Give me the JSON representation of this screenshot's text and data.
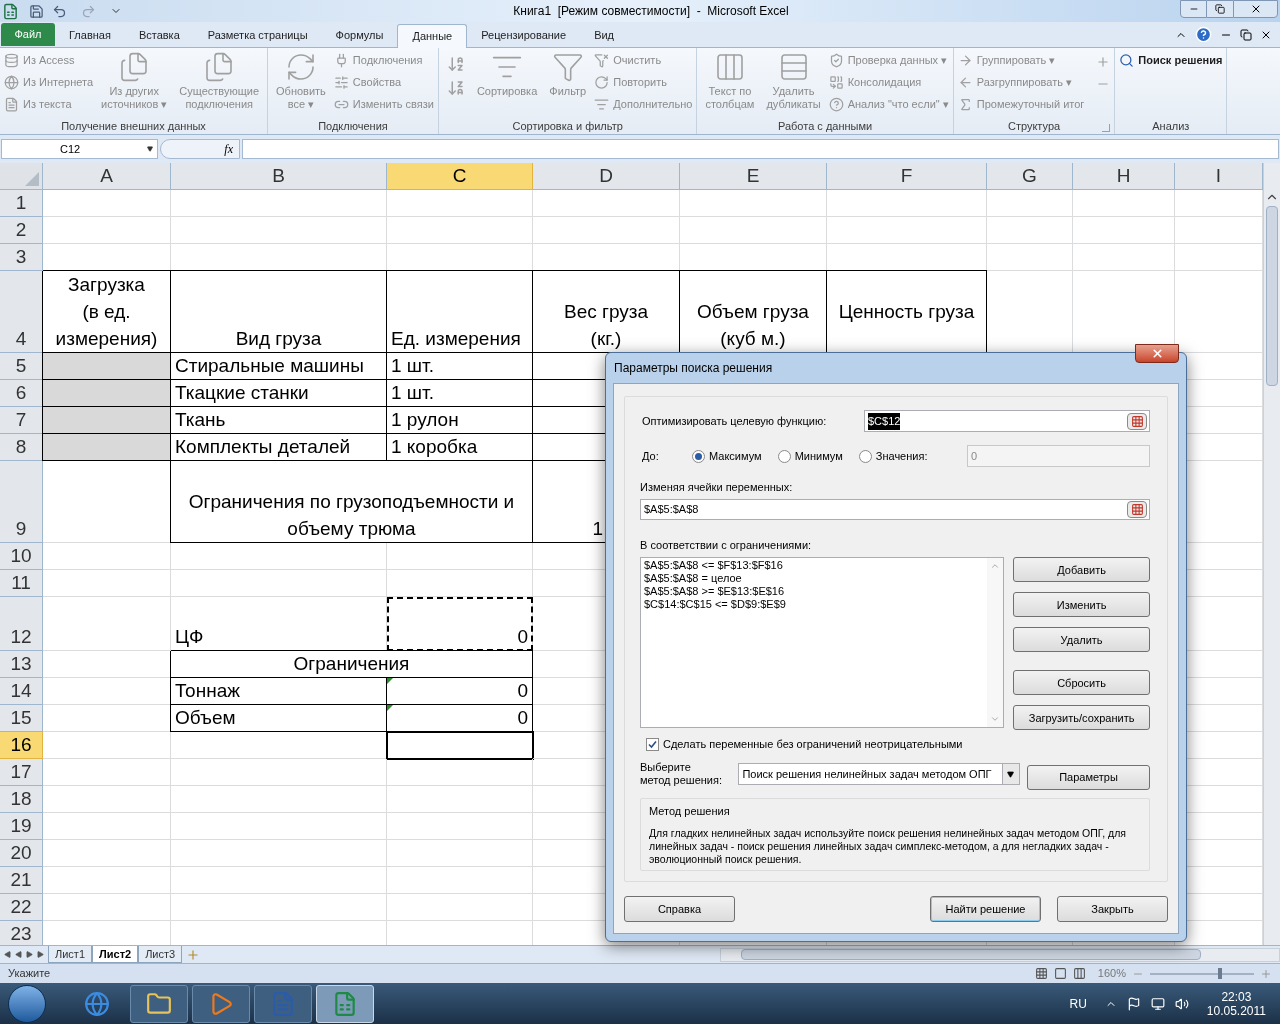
{
  "window": {
    "title": "Книга1  [Режим совместимости]  -  Microsoft Excel"
  },
  "ribbon_tabs": [
    {
      "label": "Файл",
      "kind": "file",
      "selected": false
    },
    {
      "label": "Главная",
      "kind": "tab",
      "selected": false
    },
    {
      "label": "Вставка",
      "kind": "tab",
      "selected": false
    },
    {
      "label": "Разметка страницы",
      "kind": "tab",
      "selected": false
    },
    {
      "label": "Формулы",
      "kind": "tab",
      "selected": false
    },
    {
      "label": "Данные",
      "kind": "tab",
      "selected": true
    },
    {
      "label": "Рецензирование",
      "kind": "tab",
      "selected": false
    },
    {
      "label": "Вид",
      "kind": "tab",
      "selected": false
    }
  ],
  "ribbon_groups": [
    {
      "label": "Получение внешних данных",
      "items": [
        {
          "label": "Из Access",
          "kind": "small",
          "disabled": true
        },
        {
          "label": "Из Интернета",
          "kind": "small",
          "disabled": true
        },
        {
          "label": "Из текста",
          "kind": "small",
          "disabled": true
        },
        {
          "label": "Из других\nисточников ▾",
          "kind": "large",
          "disabled": true
        },
        {
          "label": "Существующие\nподключения",
          "kind": "large",
          "disabled": true
        }
      ]
    },
    {
      "label": "Подключения",
      "items": [
        {
          "label": "Обновить\nвсе ▾",
          "kind": "large",
          "disabled": true
        },
        {
          "label": "Подключения",
          "kind": "small",
          "disabled": true
        },
        {
          "label": "Свойства",
          "kind": "small",
          "disabled": true
        },
        {
          "label": "Изменить связи",
          "kind": "small",
          "disabled": true
        }
      ]
    },
    {
      "label": "Сортировка и фильтр",
      "items": [
        {
          "label": "Сортировка",
          "kind": "large",
          "disabled": true
        },
        {
          "label": "Фильтр",
          "kind": "large",
          "disabled": true
        },
        {
          "label": "Очистить",
          "kind": "small",
          "disabled": true
        },
        {
          "label": "Повторить",
          "kind": "small",
          "disabled": true
        },
        {
          "label": "Дополнительно",
          "kind": "small",
          "disabled": true
        }
      ]
    },
    {
      "label": "Работа с данными",
      "items": [
        {
          "label": "Текст по\nстолбцам",
          "kind": "large",
          "disabled": true
        },
        {
          "label": "Удалить\nдубликаты",
          "kind": "large",
          "disabled": true
        },
        {
          "label": "Проверка данных ▾",
          "kind": "small",
          "disabled": true
        },
        {
          "label": "Консолидация",
          "kind": "small",
          "disabled": true
        },
        {
          "label": "Анализ \"что если\" ▾",
          "kind": "small",
          "disabled": true
        }
      ]
    },
    {
      "label": "Структура",
      "items": [
        {
          "label": "Группировать ▾",
          "kind": "small",
          "disabled": true
        },
        {
          "label": "Разгруппировать ▾",
          "kind": "small",
          "disabled": true
        },
        {
          "label": "Промежуточный итог",
          "kind": "small",
          "disabled": true
        }
      ]
    },
    {
      "label": "Анализ",
      "items": [
        {
          "label": "Поиск решения",
          "kind": "small",
          "disabled": false
        }
      ]
    }
  ],
  "name_box": "C12",
  "function_label": "fx",
  "columns": [
    {
      "label": "A",
      "selected": false
    },
    {
      "label": "B",
      "selected": false
    },
    {
      "label": "C",
      "selected": true
    },
    {
      "label": "D",
      "selected": false
    },
    {
      "label": "E",
      "selected": false
    },
    {
      "label": "F",
      "selected": false
    },
    {
      "label": "G",
      "selected": false
    },
    {
      "label": "H",
      "selected": false
    },
    {
      "label": "I",
      "selected": false
    }
  ],
  "rows": [
    {
      "label": "1",
      "selected": false,
      "cells": {}
    },
    {
      "label": "2",
      "selected": false,
      "cells": {}
    },
    {
      "label": "3",
      "selected": false,
      "cells": {}
    },
    {
      "label": "4",
      "selected": false,
      "cells": {
        "A": {
          "text": "Загрузка\n(в ед.\nизмерения)",
          "kind": "header",
          "boxed": true
        },
        "B": {
          "text": "Вид груза",
          "kind": "header",
          "boxed": true
        },
        "C": {
          "text": "Ед. измерения",
          "kind": "text",
          "boxed": true
        },
        "D": {
          "text": "Вес груза\n(кг.)",
          "kind": "header",
          "boxed": true
        },
        "E": {
          "text": "Объем груза\n(куб м.)",
          "kind": "header",
          "boxed": true
        },
        "F": {
          "text": "Ценность груза",
          "kind": "header_middle",
          "boxed": true
        }
      }
    },
    {
      "label": "5",
      "selected": false,
      "cells": {
        "A": {
          "shaded": true,
          "boxed": true
        },
        "B": {
          "text": "Стиральные машины",
          "kind": "text",
          "boxed": true
        },
        "C": {
          "text": "1 шт.",
          "kind": "text",
          "boxed": true
        },
        "D": {
          "boxed": true
        }
      }
    },
    {
      "label": "6",
      "selected": false,
      "cells": {
        "A": {
          "shaded": true,
          "boxed": true
        },
        "B": {
          "text": "Ткацкие станки",
          "kind": "text",
          "boxed": true
        },
        "C": {
          "text": "1 шт.",
          "kind": "text",
          "boxed": true
        },
        "D": {
          "boxed": true
        }
      }
    },
    {
      "label": "7",
      "selected": false,
      "cells": {
        "A": {
          "shaded": true,
          "boxed": true
        },
        "B": {
          "text": "Ткань",
          "kind": "text",
          "boxed": true
        },
        "C": {
          "text": "1 рулон",
          "kind": "text",
          "boxed": true
        },
        "D": {
          "boxed": true
        }
      }
    },
    {
      "label": "8",
      "selected": false,
      "cells": {
        "A": {
          "shaded": true,
          "boxed": true
        },
        "B": {
          "text": "Комплекты деталей",
          "kind": "text",
          "boxed": true
        },
        "C": {
          "text": "1 коробка",
          "kind": "text",
          "boxed": true
        },
        "D": {
          "boxed": true
        }
      }
    },
    {
      "label": "9",
      "selected": false,
      "cells": {
        "B": {
          "text": "Ограничения по грузоподъемности и\nобъему трюма",
          "kind": "header",
          "boxed": true,
          "merged": true
        },
        "D": {
          "text": "1",
          "kind": "partial",
          "boxed": true
        }
      }
    },
    {
      "label": "10",
      "selected": false,
      "cells": {}
    },
    {
      "label": "11",
      "selected": false,
      "cells": {}
    },
    {
      "label": "12",
      "selected": false,
      "cells": {
        "B": {
          "text": "ЦФ",
          "kind": "text"
        },
        "C": {
          "text": "0",
          "kind": "number",
          "marquee": true
        }
      }
    },
    {
      "label": "13",
      "selected": false,
      "cells": {
        "B": {
          "text": "Ограничения",
          "kind": "header",
          "boxed": true,
          "merged": true
        }
      }
    },
    {
      "label": "14",
      "selected": false,
      "cells": {
        "B": {
          "text": "Тоннаж",
          "kind": "text",
          "boxed": true
        },
        "C": {
          "text": "0",
          "kind": "number",
          "boxed": true,
          "flag": true
        }
      }
    },
    {
      "label": "15",
      "selected": false,
      "cells": {
        "B": {
          "text": "Объем",
          "kind": "text",
          "boxed": true
        },
        "C": {
          "text": "0",
          "kind": "number",
          "boxed": true,
          "flag": true
        }
      }
    },
    {
      "label": "16",
      "selected": true,
      "cells": {
        "C": {
          "active": true
        }
      }
    },
    {
      "label": "17",
      "selected": false,
      "cells": {}
    },
    {
      "label": "18",
      "selected": false,
      "cells": {}
    },
    {
      "label": "19",
      "selected": false,
      "cells": {}
    },
    {
      "label": "20",
      "selected": false,
      "cells": {}
    },
    {
      "label": "21",
      "selected": false,
      "cells": {}
    },
    {
      "label": "22",
      "selected": false,
      "cells": {}
    },
    {
      "label": "23",
      "selected": false,
      "cells": {}
    }
  ],
  "sheet_tabs": [
    {
      "label": "Лист1",
      "selected": false
    },
    {
      "label": "Лист2",
      "selected": true
    },
    {
      "label": "Лист3",
      "selected": false
    }
  ],
  "status_bar": {
    "mode": "Укажите",
    "zoom": "160%",
    "zoom_slider": {
      "level": 0.67
    }
  },
  "dialog": {
    "title": "Параметры поиска решения",
    "objective_label": "Оптимизировать целевую функцию:",
    "objective_value": "$C$12",
    "objective_highlighted": true,
    "to_label": "До:",
    "targets": [
      {
        "label": "Максимум",
        "selected": true
      },
      {
        "label": "Минимум",
        "selected": false
      },
      {
        "label": "Значения:",
        "selected": false
      }
    ],
    "target_value": "0",
    "target_value_disabled": true,
    "variables_label": "Изменяя ячейки переменных:",
    "variables_value": "$A$5:$A$8",
    "constraints_label": "В соответствии с ограничениями:",
    "constraints": [
      "$A$5:$A$8 <= $F$13:$F$16",
      "$A$5:$A$8 = целое",
      "$A$5:$A$8 >= $E$13:$E$16",
      "$C$14:$C$15 <= $D$9:$E$9"
    ],
    "side_buttons": [
      "Добавить",
      "Изменить",
      "Удалить",
      "Сбросить",
      "Загрузить/сохранить"
    ],
    "nonnegative": {
      "label": "Сделать переменные без ограничений неотрицательными",
      "checked": true
    },
    "method_label": "Выберите\nметод решения:",
    "method_value": "Поиск решения нелинейных задач методом ОПГ",
    "params_button": "Параметры",
    "method_box": {
      "title": "Метод решения",
      "text": "Для гладких нелинейных задач используйте поиск решения нелинейных задач методом ОПГ, для линейных задач - поиск решения линейных задач симплекс-методом, а для негладких задач - эволюционный поиск решения."
    },
    "buttons": [
      {
        "label": "Справка",
        "default": false
      },
      {
        "label": "Найти решение",
        "default": true
      },
      {
        "label": "Закрыть",
        "default": false
      }
    ]
  },
  "taskbar": {
    "language": "RU",
    "time": "22:03",
    "date": "10.05.2011"
  }
}
